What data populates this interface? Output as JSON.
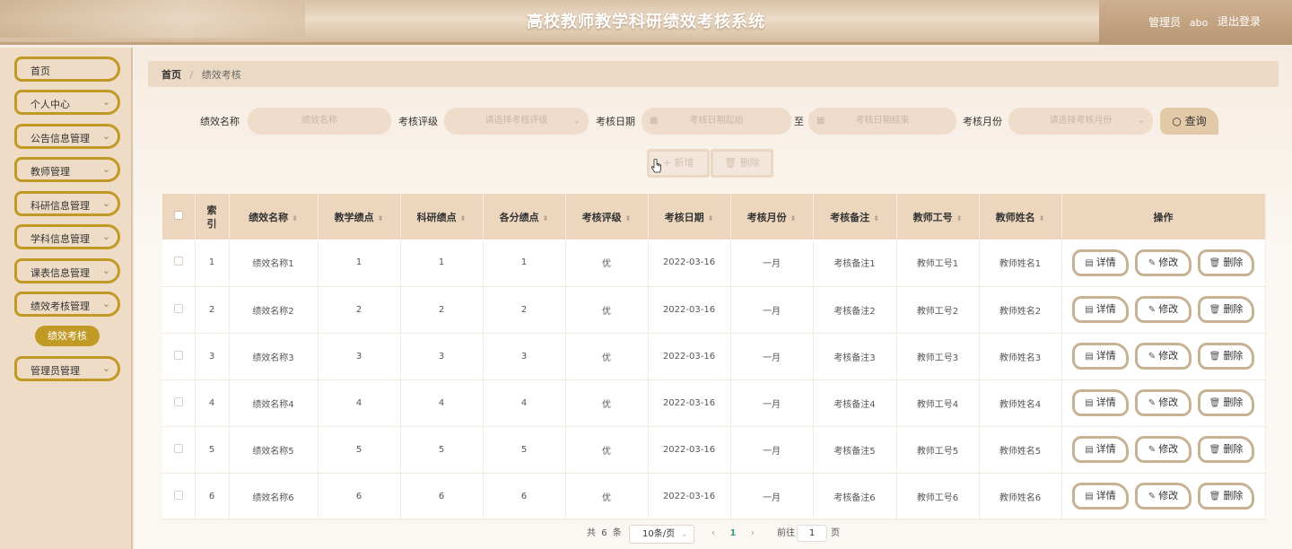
{
  "header": {
    "title": "高校教师教学科研绩效考核系统",
    "role": "管理员",
    "username": "abo",
    "logout": "退出登录"
  },
  "sidebar": {
    "items": [
      {
        "label": "首页",
        "has_chevron": false
      },
      {
        "label": "个人中心",
        "has_chevron": true
      },
      {
        "label": "公告信息管理",
        "has_chevron": true
      },
      {
        "label": "教师管理",
        "has_chevron": true
      },
      {
        "label": "科研信息管理",
        "has_chevron": true
      },
      {
        "label": "学科信息管理",
        "has_chevron": true
      },
      {
        "label": "课表信息管理",
        "has_chevron": true
      },
      {
        "label": "绩效考核管理",
        "has_chevron": true
      },
      {
        "label": "管理员管理",
        "has_chevron": true
      }
    ],
    "active_sub": "绩效考核"
  },
  "breadcrumb": {
    "home": "首页",
    "current": "绩效考核"
  },
  "search": {
    "name_label": "绩效名称",
    "name_placeholder": "绩效名称",
    "grade_label": "考核评级",
    "grade_placeholder": "请选择考核评级",
    "date_label": "考核日期",
    "date_start_placeholder": "考核日期起始",
    "date_to": "至",
    "date_end_placeholder": "考核日期结束",
    "month_label": "考核月份",
    "month_placeholder": "请选择考核月份",
    "search_button": "查询"
  },
  "actions": {
    "add": "新增",
    "delete": "删除"
  },
  "table": {
    "headers": [
      "索引",
      "绩效名称",
      "教学绩点",
      "科研绩点",
      "各分绩点",
      "考核评级",
      "考核日期",
      "考核月份",
      "考核备注",
      "教师工号",
      "教师姓名",
      "操作"
    ],
    "rows": [
      {
        "index": "1",
        "name": "绩效名称1",
        "teach": "1",
        "research": "1",
        "score": "1",
        "grade": "优",
        "date": "2022-03-16",
        "month": "一月",
        "note": "考核备注1",
        "tid": "教师工号1",
        "tname": "教师姓名1"
      },
      {
        "index": "2",
        "name": "绩效名称2",
        "teach": "2",
        "research": "2",
        "score": "2",
        "grade": "优",
        "date": "2022-03-16",
        "month": "一月",
        "note": "考核备注2",
        "tid": "教师工号2",
        "tname": "教师姓名2"
      },
      {
        "index": "3",
        "name": "绩效名称3",
        "teach": "3",
        "research": "3",
        "score": "3",
        "grade": "优",
        "date": "2022-03-16",
        "month": "一月",
        "note": "考核备注3",
        "tid": "教师工号3",
        "tname": "教师姓名3"
      },
      {
        "index": "4",
        "name": "绩效名称4",
        "teach": "4",
        "research": "4",
        "score": "4",
        "grade": "优",
        "date": "2022-03-16",
        "month": "一月",
        "note": "考核备注4",
        "tid": "教师工号4",
        "tname": "教师姓名4"
      },
      {
        "index": "5",
        "name": "绩效名称5",
        "teach": "5",
        "research": "5",
        "score": "5",
        "grade": "优",
        "date": "2022-03-16",
        "month": "一月",
        "note": "考核备注5",
        "tid": "教师工号5",
        "tname": "教师姓名5"
      },
      {
        "index": "6",
        "name": "绩效名称6",
        "teach": "6",
        "research": "6",
        "score": "6",
        "grade": "优",
        "date": "2022-03-16",
        "month": "一月",
        "note": "考核备注6",
        "tid": "教师工号6",
        "tname": "教师姓名6"
      }
    ],
    "row_ops": {
      "detail": "详情",
      "edit": "修改",
      "delete": "删除"
    }
  },
  "pagination": {
    "total_prefix": "共",
    "total": "6",
    "total_suffix": "条",
    "page_size": "10条/页",
    "prev": "‹",
    "current_page": "1",
    "next": "›",
    "goto_label": "前往",
    "goto_value": "1",
    "goto_suffix": "页"
  },
  "colors": {
    "accent": "#c19a25",
    "header_bg": "#ecd7be",
    "sidebar_bg": "#efdcc6"
  }
}
